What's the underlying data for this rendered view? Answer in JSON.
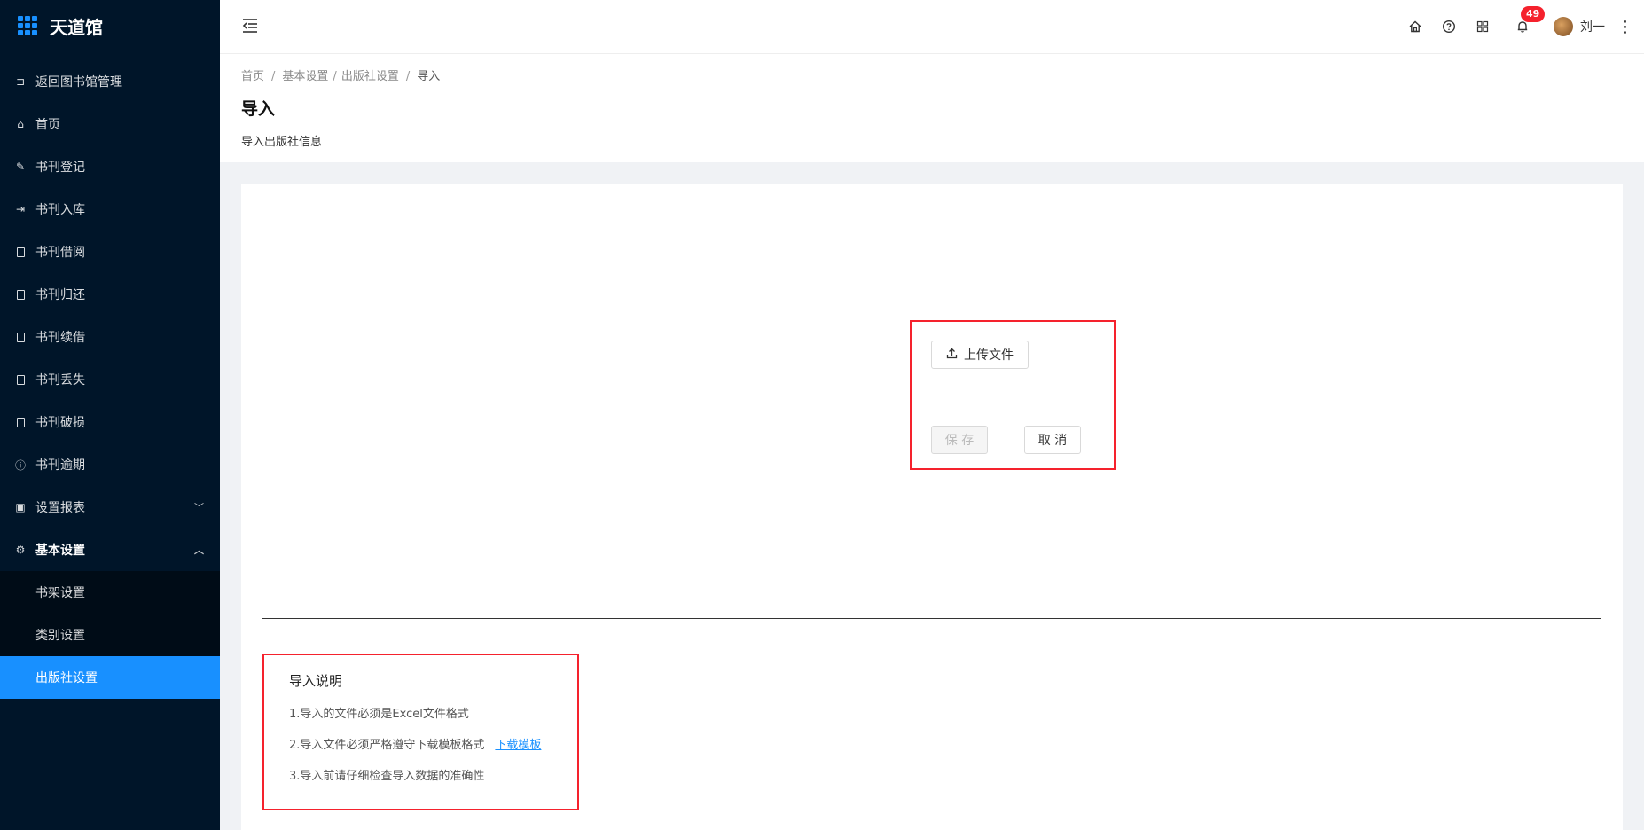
{
  "app": {
    "title": "天道馆"
  },
  "sidebar": {
    "items": [
      {
        "label": "返回图书馆管理",
        "icon": "return-icon"
      },
      {
        "label": "首页",
        "icon": "home-icon"
      },
      {
        "label": "书刊登记",
        "icon": "pen-icon"
      },
      {
        "label": "书刊入库",
        "icon": "login-icon"
      },
      {
        "label": "书刊借阅",
        "icon": "document-icon"
      },
      {
        "label": "书刊归还",
        "icon": "document-icon"
      },
      {
        "label": "书刊续借",
        "icon": "document-icon"
      },
      {
        "label": "书刊丢失",
        "icon": "document-icon"
      },
      {
        "label": "书刊破损",
        "icon": "document-icon"
      },
      {
        "label": "书刊逾期",
        "icon": "info-icon"
      },
      {
        "label": "设置报表",
        "icon": "report-icon"
      },
      {
        "label": "基本设置",
        "icon": "gear-icon"
      }
    ],
    "submenu": [
      {
        "label": "书架设置"
      },
      {
        "label": "类别设置"
      },
      {
        "label": "出版社设置"
      }
    ]
  },
  "header": {
    "notification_count": "49",
    "username": "刘一"
  },
  "breadcrumb": [
    "首页",
    "基本设置",
    "出版社设置",
    "导入"
  ],
  "page": {
    "title": "导入",
    "description": "导入出版社信息"
  },
  "upload": {
    "upload_label": "上传文件",
    "save_label": "保 存",
    "cancel_label": "取 消"
  },
  "instructions": {
    "title": "导入说明",
    "line1": "1.导入的文件必须是Excel文件格式",
    "line2": "2.导入文件必须严格遵守下载模板格式",
    "download_link": "下载模板",
    "line3": "3.导入前请仔细检查导入数据的准确性"
  },
  "colors": {
    "sidebar_bg": "#001529",
    "accent": "#1890ff",
    "highlight_border": "#f5222d"
  }
}
